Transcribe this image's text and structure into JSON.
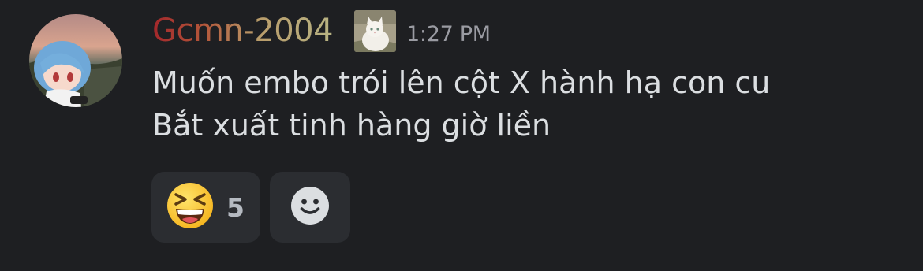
{
  "message": {
    "author": "Gcmn-2004",
    "timestamp": "1:27 PM",
    "lines": [
      "Muốn embo trói lên cột X hành hạ con cu",
      "Bắt xuất tinh hàng giờ liền"
    ],
    "avatar_icon": "anime-figure-avatar",
    "role_icon": "white-cat-photo-icon"
  },
  "reactions": [
    {
      "emoji": "grinning-squinting-face-icon",
      "count": "5"
    }
  ],
  "add_reaction": {
    "icon": "smiley-add-reaction-icon"
  },
  "colors": {
    "background": "#1e1f22",
    "text": "#dbdee1",
    "timestamp": "#9a9ba2",
    "reaction_bg": "#2b2d31",
    "username_gradient": [
      "#a3272b",
      "#b4563a",
      "#b99c6a",
      "#b8b383"
    ]
  }
}
